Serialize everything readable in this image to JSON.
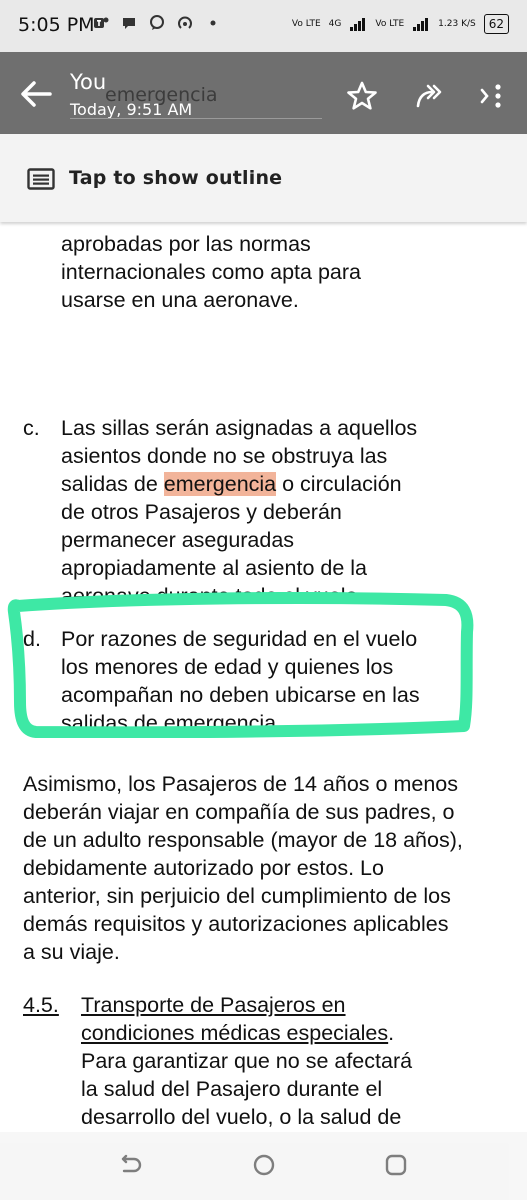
{
  "status_bar": {
    "time": "5:05 PM",
    "net1": "Vo LTE",
    "net1a": "4G",
    "net2": "Vo LTE",
    "speed": "1.23 K/S",
    "battery": "62"
  },
  "header": {
    "title": "You",
    "subtitle": "Today, 9:51 AM",
    "search_text": "emergencia"
  },
  "outline": {
    "label": "Tap to show outline"
  },
  "document": {
    "para1": [
      "aprobadas por las normas",
      "internacionales como apta para",
      "usarse en una aeronave."
    ],
    "item_c": {
      "marker": "c.",
      "l1": "Las sillas serán asignadas a aquellos",
      "l2": "asientos donde no se obstruya las",
      "l3a": "salidas de ",
      "l3hl": "emergencia",
      "l3b": " o circulación",
      "l4": "de otros Pasajeros y deberán",
      "l5": "permanecer aseguradas",
      "l6": "apropiadamente al asiento de la",
      "l7": "aeronave durante todo el vuelo."
    },
    "item_d": {
      "marker": "d.",
      "lines": [
        "Por razones de seguridad en el vuelo",
        "los menores de edad y quienes los",
        "acompañan no deben ubicarse en las",
        "salidas de emergencia."
      ]
    },
    "para2": [
      "Asimismo, los Pasajeros de 14 años o menos",
      "deberán viajar en compañía de sus padres, o",
      "de un adulto responsable (mayor de 18 años),",
      "debidamente autorizado por estos. Lo",
      "anterior, sin perjuicio del cumplimiento de los",
      "demás requisitos y autorizaciones aplicables",
      "a su viaje."
    ],
    "section": {
      "number": "4.5.",
      "title1": "Transporte de Pasajeros en",
      "title2": "condiciones médicas especiales",
      "title_end": ".",
      "lines": [
        "Para garantizar que no se afectará",
        "la salud del Pasajero durante el",
        "desarrollo del vuelo, o la salud de"
      ]
    }
  }
}
